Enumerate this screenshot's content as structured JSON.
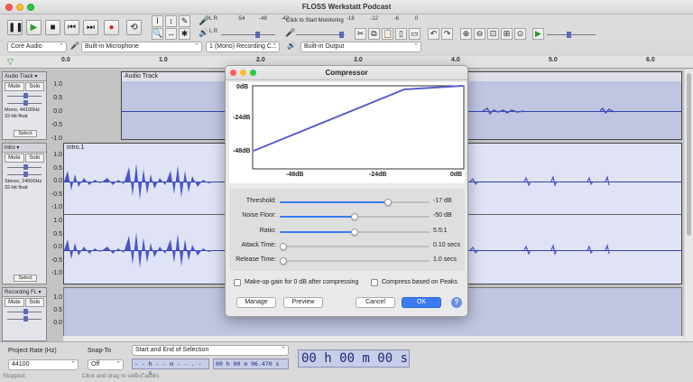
{
  "window": {
    "title": "FLOSS Werkstatt Podcast"
  },
  "toolbar": {
    "monitor_label": "Click to Start Monitoring",
    "rec_meter_ticks": [
      "-54",
      "-48",
      "-42"
    ],
    "play_meter_ticks": [
      "-54",
      "-48",
      "-42",
      "-36",
      "-30",
      "-24",
      "-18",
      "-12",
      "-6",
      "0"
    ],
    "rec_meter_scale": [
      "-18",
      "-12",
      "-6",
      "0"
    ]
  },
  "devices": {
    "host": "Core Audio",
    "input": "Built-in Microphone",
    "channels": "1 (Mono) Recording C...",
    "output": "Built-in Output"
  },
  "ruler": {
    "ticks": [
      "0.0",
      "1.0",
      "2.0",
      "3.0",
      "4.0",
      "5.0",
      "6.0"
    ]
  },
  "tracks": [
    {
      "name": "Audio Track",
      "clip_name": "Audio Track",
      "mute": "Mute",
      "solo": "Solo",
      "info_line1": "Mono, 44100Hz",
      "info_line2": "32-bit float",
      "select": "Select",
      "scale": [
        "1.0",
        "0.5",
        "0.0",
        "-0.5",
        "-1.0"
      ]
    },
    {
      "name": "intro",
      "clip_name": "intro.1",
      "mute": "Mute",
      "solo": "Solo",
      "info_line1": "Stereo, 24000Hz",
      "info_line2": "32-bit float",
      "select": "Select",
      "scale": [
        "1.0",
        "0.5",
        "0.0",
        "-0.5",
        "-1.0",
        "1.0",
        "0.5",
        "0.0",
        "-0.5",
        "-1.0"
      ]
    },
    {
      "name": "Recording FL",
      "clip_name": "",
      "mute": "Mute",
      "solo": "Solo",
      "scale": [
        "1.0",
        "0.5",
        "0.0"
      ]
    }
  ],
  "bottom": {
    "project_rate_label": "Project Rate (Hz)",
    "project_rate_value": "44100",
    "snap_label": "Snap-To",
    "snap_value": "Off",
    "selection_mode": "Start and End of Selection",
    "sel_start": "- - h - - m - - . - - - s",
    "sel_end": "00 h 00 m 06.470 s",
    "audio_position": "00 h 00 m 00 s"
  },
  "status": {
    "text": "Stopped.",
    "hint": "Click and drag to select audio"
  },
  "dialog": {
    "title": "Compressor",
    "graph": {
      "y_labels": [
        "0dB",
        "-24dB",
        "-48dB"
      ],
      "x_labels": [
        "-48dB",
        "-24dB",
        "0dB"
      ]
    },
    "params": [
      {
        "label": "Threshold:",
        "value": "-17 dB",
        "position": 0.72
      },
      {
        "label": "Noise Floor:",
        "value": "-50 dB",
        "position": 0.5
      },
      {
        "label": "Ratio:",
        "value": "5.5:1",
        "position": 0.5
      },
      {
        "label": "Attack Time:",
        "value": "0.10 secs",
        "position": 0.02
      },
      {
        "label": "Release Time:",
        "value": "1.0 secs",
        "position": 0.02
      }
    ],
    "makeup_gain": "Make-up gain for 0 dB after compressing",
    "peaks": "Compress based on Peaks",
    "manage": "Manage",
    "preview": "Preview",
    "cancel": "Cancel",
    "ok": "OK",
    "help": "?",
    "accent_color": "#3a7cf0",
    "curve_color": "#5a5fc9"
  }
}
